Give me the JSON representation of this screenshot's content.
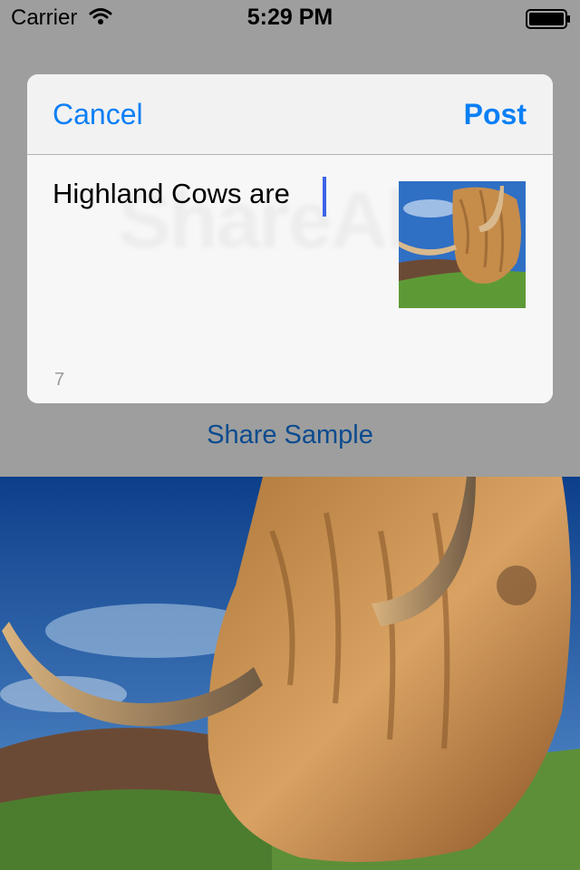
{
  "status_bar": {
    "carrier": "Carrier",
    "time": "5:29 PM"
  },
  "compose": {
    "cancel_label": "Cancel",
    "post_label": "Post",
    "text": "Highland Cows are",
    "watermark": "ShareAlike",
    "char_count": "7"
  },
  "background_app": {
    "share_button_label": "Share Sample"
  },
  "colors": {
    "accent": "#0b7ff5",
    "share_link": "#0b4b8f",
    "caret": "#3d63e6"
  },
  "icons": [
    "wifi-icon",
    "battery-icon"
  ]
}
